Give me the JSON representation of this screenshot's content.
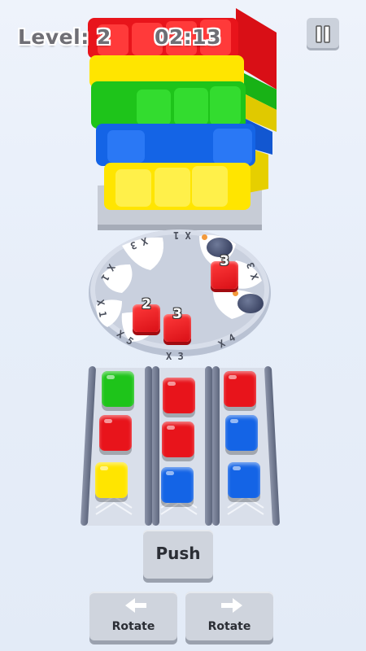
{
  "hud": {
    "level_text": "Level: 2",
    "timer_text": "02:13",
    "pause_icon": "pause-icon"
  },
  "colors": {
    "red": "#e8141b",
    "yellow": "#ffe500",
    "green": "#1ec41a",
    "blue": "#1464e6",
    "button": "#cfd4dd"
  },
  "cube": {
    "layers_top_to_bottom": [
      "red",
      "yellow",
      "green",
      "blue",
      "yellow"
    ]
  },
  "dial": {
    "labels": [
      "X 1",
      "X 3",
      "X 3",
      "X 1",
      "X 1",
      "X 5",
      "X 3",
      "X 4"
    ],
    "pieces": [
      {
        "color": "red",
        "count": "3"
      },
      {
        "color": "red",
        "count": "2"
      },
      {
        "color": "red",
        "count": "3"
      }
    ],
    "bombs": 2
  },
  "lanes": [
    {
      "blocks": [
        "green",
        "red",
        "yellow"
      ]
    },
    {
      "blocks": [
        "red",
        "red",
        "blue"
      ]
    },
    {
      "blocks": [
        "red",
        "blue",
        "blue"
      ]
    }
  ],
  "buttons": {
    "push_label": "Push",
    "rotate_left_label": "Rotate",
    "rotate_right_label": "Rotate",
    "rotate_left_icon": "arrow-left-icon",
    "rotate_right_icon": "arrow-right-icon"
  }
}
